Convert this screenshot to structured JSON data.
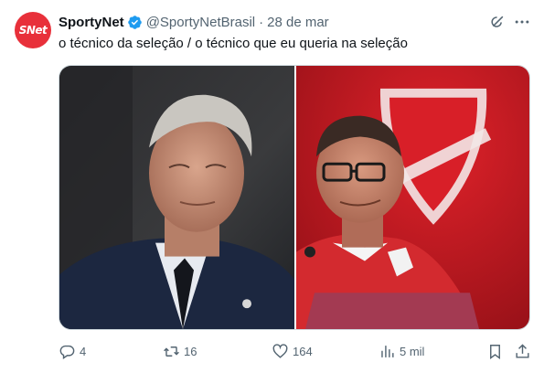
{
  "tweet": {
    "avatar_text": "SNet",
    "display_name": "SportyNet",
    "handle": "@SportyNetBrasil",
    "separator": "·",
    "date": "28 de mar",
    "text": "o técnico da seleção / o técnico que eu queria na seleção",
    "brand_color": "#e8303a",
    "verified_color": "#1d9bf0"
  },
  "media": {
    "left_image": "photo-older-man-in-suit",
    "right_image": "photo-man-in-red-jacket-with-club-crest"
  },
  "actions": {
    "reply_count": "4",
    "retweet_count": "16",
    "like_count": "164",
    "views_count": "5 mil",
    "icons": [
      "reply-icon",
      "retweet-icon",
      "like-icon",
      "views-icon",
      "bookmark-icon",
      "share-icon"
    ]
  }
}
